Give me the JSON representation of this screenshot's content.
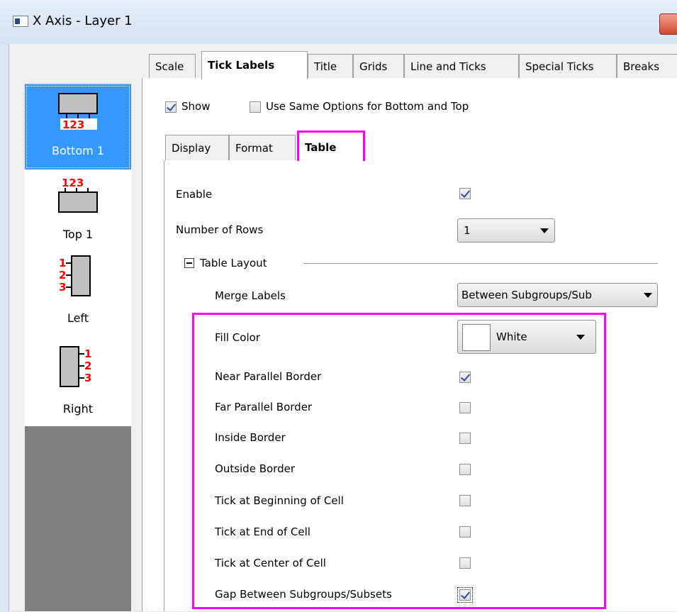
{
  "window": {
    "title": "X Axis - Layer 1"
  },
  "sidebar": {
    "items": [
      {
        "label": "Bottom 1",
        "icon": "axis-bottom-icon",
        "selected": true
      },
      {
        "label": "Top 1",
        "icon": "axis-top-icon",
        "selected": false
      },
      {
        "label": "Left",
        "icon": "axis-left-icon",
        "selected": false
      },
      {
        "label": "Right",
        "icon": "axis-right-icon",
        "selected": false
      }
    ]
  },
  "tabs": [
    "Scale",
    "Tick Labels",
    "Title",
    "Grids",
    "Line and Ticks",
    "Special Ticks",
    "Breaks"
  ],
  "active_tab": "Tick Labels",
  "options": {
    "show_label": "Show",
    "show_checked": true,
    "same_options_label": "Use Same Options for Bottom and Top",
    "same_options_checked": false
  },
  "subtabs": [
    "Display",
    "Format",
    "Table"
  ],
  "active_subtab": "Table",
  "table": {
    "enable_label": "Enable",
    "enable_checked": true,
    "rows_label": "Number of Rows",
    "rows_value": "1",
    "layout_group": "Table Layout",
    "merge_label": "Merge Labels",
    "merge_value": "Between Subgroups/Sub",
    "fill_color_label": "Fill Color",
    "fill_color_value": "White",
    "fill_color_hex": "#ffffff",
    "settings": [
      {
        "label": "Near Parallel Border",
        "checked": true
      },
      {
        "label": "Far Parallel Border",
        "checked": false
      },
      {
        "label": "Inside Border",
        "checked": false
      },
      {
        "label": "Outside Border",
        "checked": false
      },
      {
        "label": "Tick at Beginning of Cell",
        "checked": false
      },
      {
        "label": "Tick at End of Cell",
        "checked": false
      },
      {
        "label": "Tick at Center of Cell",
        "checked": false
      },
      {
        "label": "Gap Between Subgroups/Subsets",
        "checked": true
      }
    ]
  },
  "colors": {
    "selection": "#3399ff",
    "highlight": "#ff00ff",
    "tick_digits": "#ff0000"
  }
}
